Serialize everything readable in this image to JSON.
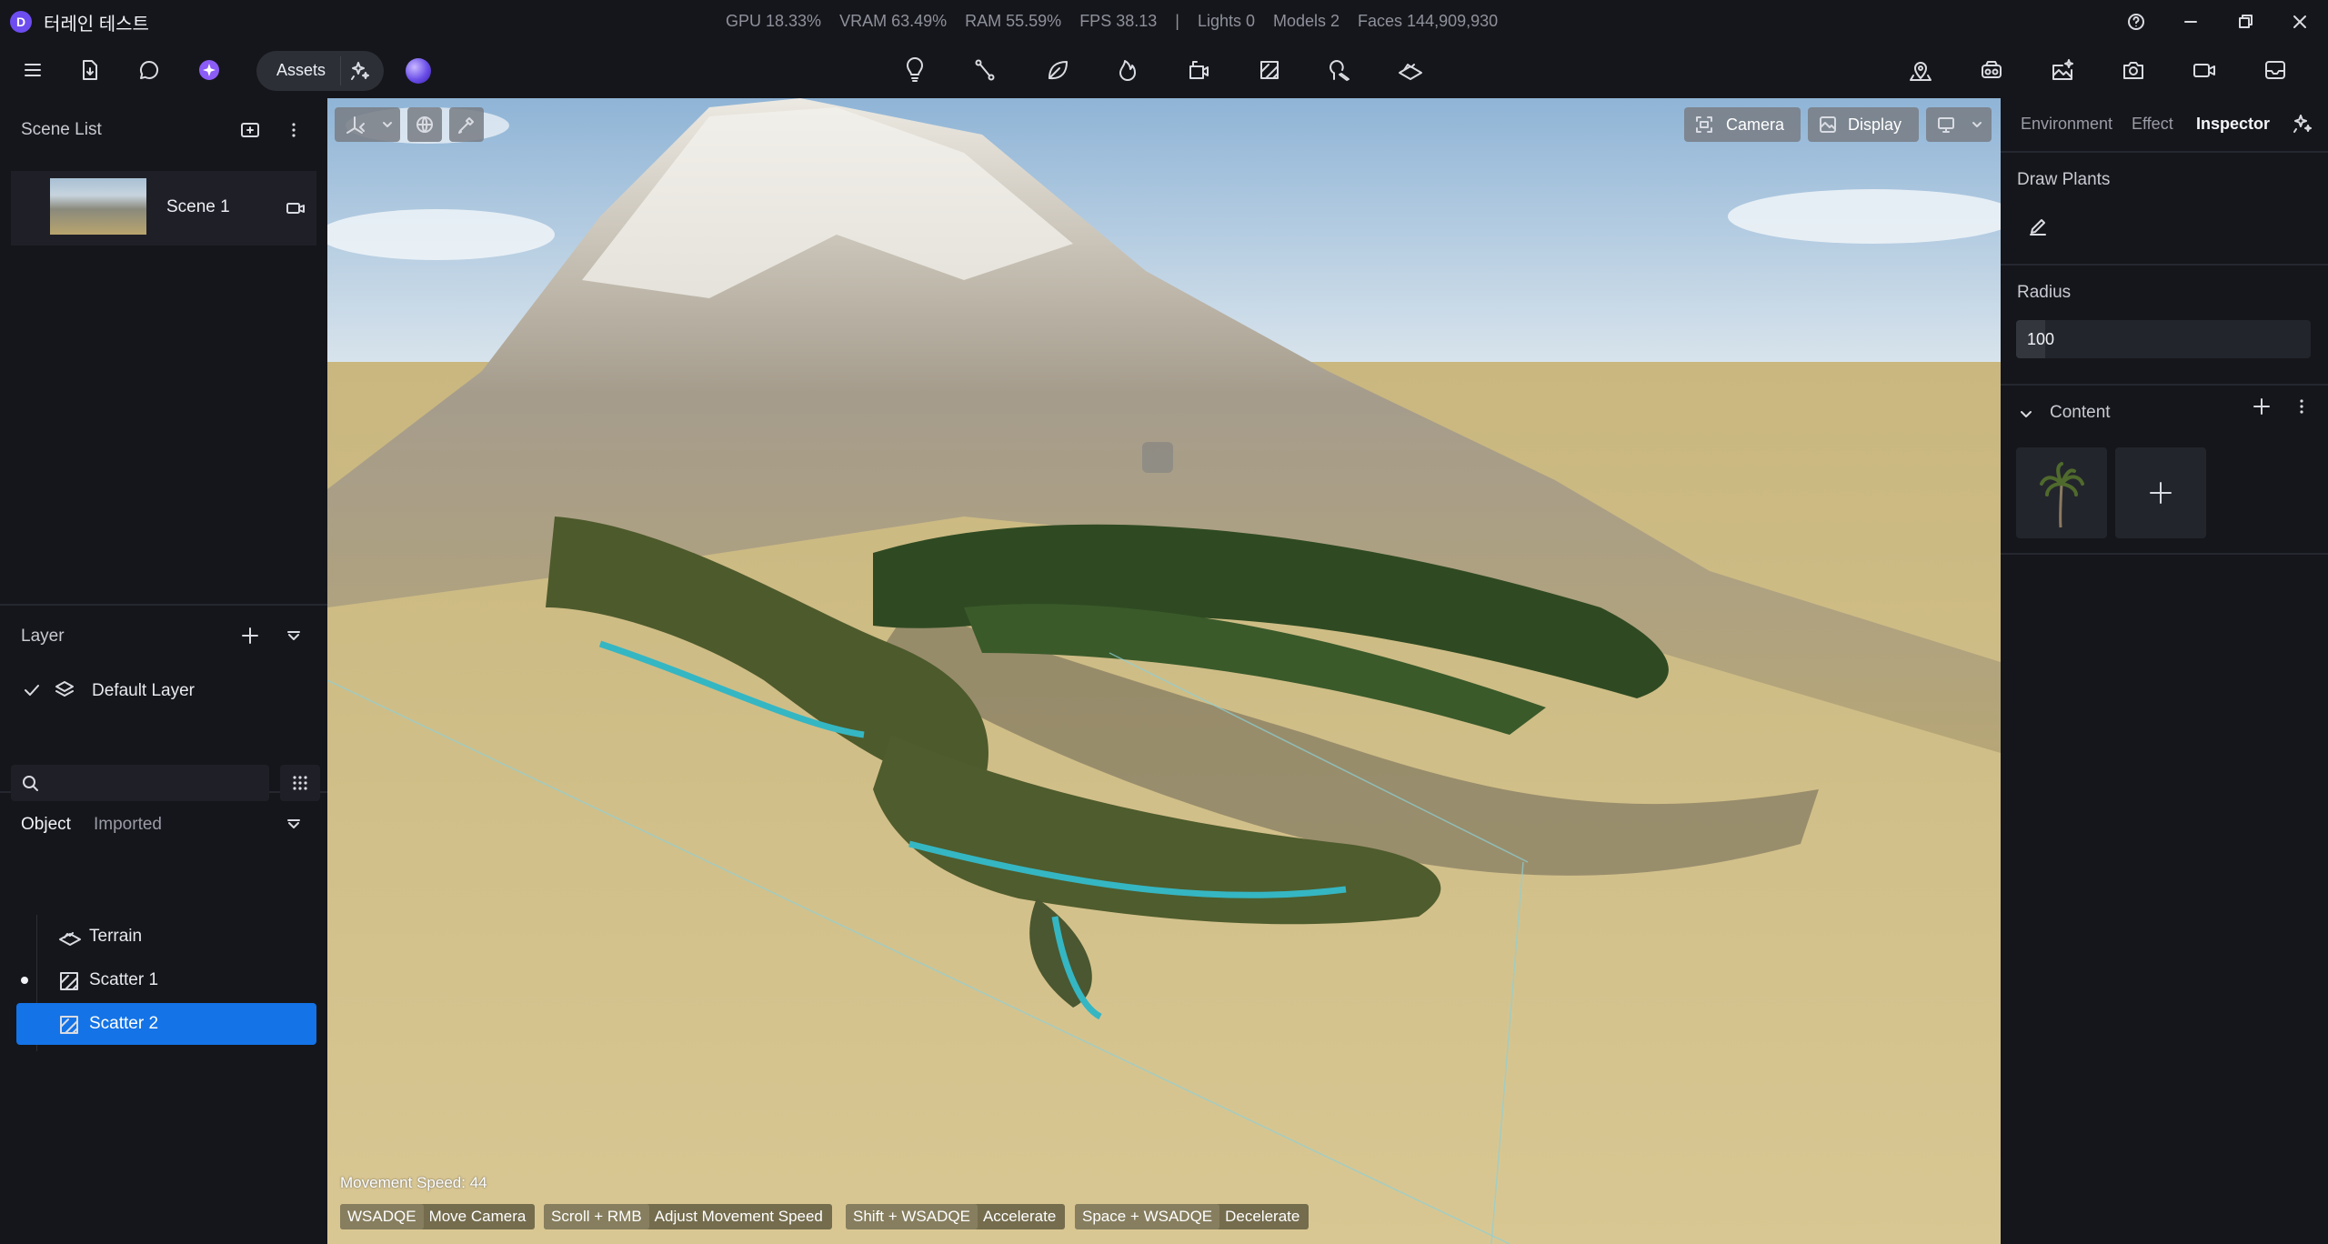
{
  "app": {
    "title": "터레인 테스트",
    "logo_letter": "D"
  },
  "stats": {
    "gpu": "GPU 18.33%",
    "vram": "VRAM 63.49%",
    "ram": "RAM 55.59%",
    "fps": "FPS 38.13",
    "sep": "|",
    "lights": "Lights 0",
    "models": "Models 2",
    "faces": "Faces 144,909,930"
  },
  "toolbar": {
    "assets_label": "Assets",
    "center_tools": [
      "light-bulb-icon",
      "path-icon",
      "leaf-icon",
      "fire-icon",
      "robot-arm-icon",
      "scatter-icon",
      "brush-tree-icon",
      "terrain-icon"
    ],
    "right_tools": [
      "map-pin-icon",
      "vr-headset-icon",
      "image-sparkle-icon",
      "camera-icon",
      "video-icon",
      "inbox-icon"
    ]
  },
  "left": {
    "scene_list": {
      "title": "Scene List",
      "items": [
        {
          "name": "Scene 1"
        }
      ]
    },
    "layer": {
      "title": "Layer",
      "items": [
        {
          "name": "Default Layer",
          "checked": true
        }
      ]
    },
    "objects": {
      "tabs": [
        "Object",
        "Imported"
      ],
      "active_tab": "Object",
      "search_placeholder": "",
      "items": [
        {
          "name": "Terrain",
          "selected": false
        },
        {
          "name": "Scatter 1",
          "selected": false
        },
        {
          "name": "Scatter 2",
          "selected": true
        }
      ]
    }
  },
  "viewport": {
    "buttons": {
      "camera": "Camera",
      "display": "Display"
    },
    "movement_speed": "Movement Speed: 44",
    "hints": [
      {
        "key": "WSADQE",
        "desc": "Move Camera"
      },
      {
        "key": "Scroll + RMB",
        "desc": "Adjust Movement Speed"
      },
      {
        "key": "Shift + WSADQE",
        "desc": "Accelerate"
      },
      {
        "key": "Space + WSADQE",
        "desc": "Decelerate"
      }
    ]
  },
  "inspector": {
    "tabs": [
      "Environment",
      "Effect",
      "Inspector"
    ],
    "active_tab": "Inspector",
    "draw_plants": {
      "title": "Draw Plants"
    },
    "radius": {
      "title": "Radius",
      "value": "100",
      "fill_fraction": 0.1
    },
    "content": {
      "title": "Content",
      "items": [
        "palm-tree-thumbnail"
      ]
    }
  },
  "colors": {
    "accent": "#1473e6",
    "bg": "#15161b",
    "panel": "#1f2027",
    "selected_row": "#1473e6"
  }
}
